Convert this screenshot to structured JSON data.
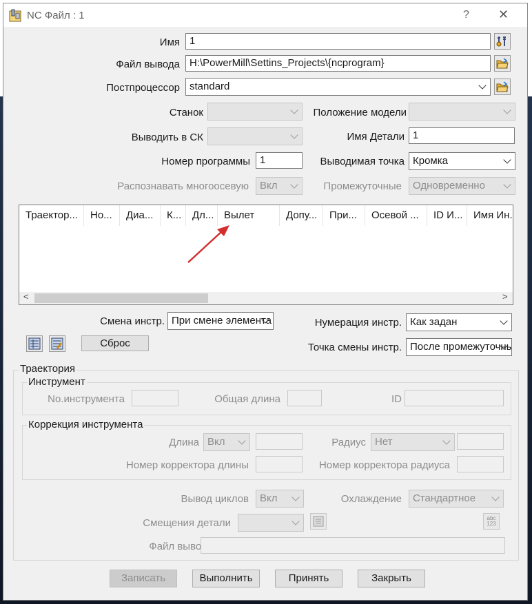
{
  "window": {
    "title": "NC Файл : 1",
    "help_glyph": "?",
    "close_glyph": "✕"
  },
  "top": {
    "name_label": "Имя",
    "name_value": "1",
    "output_file_label": "Файл вывода",
    "output_file_value": "H:\\PowerMill\\Settins_Projects\\{ncprogram}",
    "postprocessor_label": "Постпроцессор",
    "postprocessor_value": "standard"
  },
  "options": {
    "machine_label": "Станок",
    "machine_value": "",
    "model_position_label": "Положение модели",
    "model_position_value": "",
    "output_cs_label": "Выводить в СК",
    "output_cs_value": "",
    "part_name_label": "Имя Детали",
    "part_name_value": "1",
    "program_number_label": "Номер программы",
    "program_number_value": "1",
    "output_point_label": "Выводимая точка",
    "output_point_value": "Кромка",
    "multiaxis_label": "Распознавать многоосевую",
    "multiaxis_value": "Вкл",
    "intermediate_label": "Промежуточные",
    "intermediate_value": "Одновременно"
  },
  "grid": {
    "columns": [
      "Траектор...",
      "Но...",
      "Диа...",
      "К...",
      "Дл...",
      "Вылет",
      "Допу...",
      "При...",
      "Осевой ...",
      "ID И...",
      "Имя Ин..."
    ],
    "scroll_left": "<",
    "scroll_right": ">"
  },
  "tool_change": {
    "change_label": "Смена инстр.",
    "change_value": "При смене элемента",
    "numbering_label": "Нумерация инстр.",
    "numbering_value": "Как задан",
    "change_point_label": "Точка смены инстр.",
    "change_point_value": "После промежуточных",
    "reset_button": "Сброс"
  },
  "toolpath": {
    "section_title": "Траектория",
    "tool_group": "Инструмент",
    "tool_number_label": "No.инструмента",
    "tool_number_value": "",
    "total_length_label": "Общая длина",
    "total_length_value": "",
    "id_label": "ID",
    "id_value": "",
    "compensation_group": "Коррекция инструмента",
    "length_label": "Длина",
    "length_value": "Вкл",
    "length_extra": "",
    "radius_label": "Радиус",
    "radius_value": "Нет",
    "radius_extra": "",
    "length_register_label": "Номер корректора длины",
    "length_register_value": "",
    "radius_register_label": "Номер корректора радиуса",
    "radius_register_value": "",
    "cycles_label": "Вывод циклов",
    "cycles_value": "Вкл",
    "coolant_label": "Охлаждение",
    "coolant_value": "Стандартное",
    "workplane_offset_label": "Смещения детали",
    "workplane_offset_value": "",
    "file_label": "Файл вывода",
    "file_value": "",
    "abc_icon_text": "abc\n123"
  },
  "footer": {
    "write": "Записать",
    "execute": "Выполнить",
    "accept": "Принять",
    "close": "Закрыть"
  },
  "colors": {
    "dialog_bg": "#f0f0f0",
    "arrow": "#d32f2f",
    "disabled_text": "#8d8d8d"
  }
}
